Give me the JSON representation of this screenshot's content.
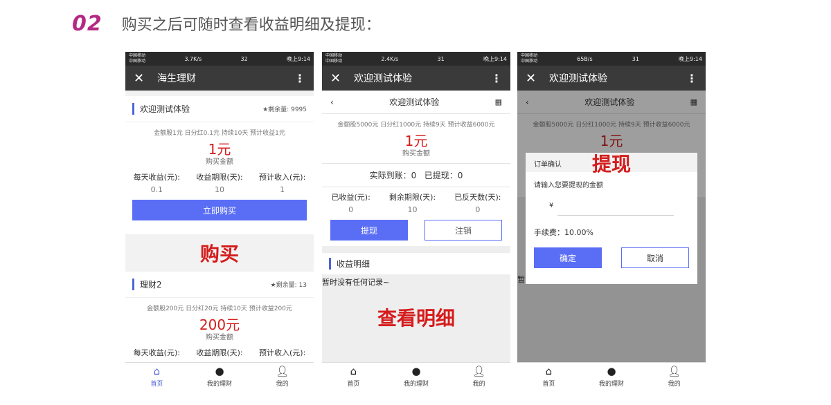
{
  "heading": {
    "number": "02",
    "text": "购买之后可随时查看收益明细及提现："
  },
  "phone1": {
    "status": {
      "carrier1": "中国移动",
      "carrier2": "中国移动",
      "speed": "3.7K/s",
      "battery": "32",
      "time": "晚上9:14"
    },
    "title": "海生理财",
    "products": [
      {
        "name": "欢迎测试体验",
        "stock_label": "剩余量:",
        "stock": "9995",
        "terms": "金额股1元 日分红0.1元 持续10天 预计收益1元",
        "price": "1元",
        "price_sub": "购买金额",
        "stats": [
          {
            "label": "每天收益(元):",
            "value": "0.1"
          },
          {
            "label": "收益期限(天):",
            "value": "10"
          },
          {
            "label": "预计收入(元):",
            "value": "1"
          }
        ],
        "button": "立即购买"
      },
      {
        "name": "理财2",
        "stock_label": "剩余量:",
        "stock": "13",
        "terms": "金额股200元 日分红20元 持续10天 预计收益200元",
        "price": "200元",
        "price_sub": "购买金额",
        "stats": [
          {
            "label": "每天收益(元):"
          },
          {
            "label": "收益期限(天):"
          },
          {
            "label": "预计收入(元):"
          }
        ]
      }
    ],
    "annotation": "购买"
  },
  "phone2": {
    "status": {
      "speed": "2.4K/s",
      "battery": "31",
      "time": "晚上9:14"
    },
    "title": "欢迎测试体验",
    "subtitle": "欢迎测试体验",
    "terms": "金额股5000元 日分红1000元 持续9天 预计收益6000元",
    "price": "1元",
    "price_sub": "购买金额",
    "balance": "实际到账：0   已提现：0",
    "stats": [
      {
        "label": "已收益(元):",
        "value": "0"
      },
      {
        "label": "剩余期限(天):",
        "value": "10"
      },
      {
        "label": "已反天数(天):",
        "value": "0"
      }
    ],
    "withdraw_button": "提现",
    "cancel_button": "注销",
    "details_title": "收益明细",
    "empty_text": "暂时没有任何记录~",
    "annotation": "查看明细"
  },
  "phone3": {
    "status": {
      "speed": "65B/s",
      "battery": "31",
      "time": "晚上9:14"
    },
    "title": "欢迎测试体验",
    "subtitle": "欢迎测试体验",
    "terms": "金额股5000元 日分红1000元 持续9天 预计收益6000元",
    "price": "1元",
    "dialog": {
      "title": "订单确认",
      "prompt": "请输入您要提现的金额",
      "currency": "¥",
      "fee": "手续费：10.00%",
      "confirm": "确定",
      "cancel": "取消"
    },
    "annotation": "提现",
    "partial_text": "暂"
  },
  "tabbar": [
    {
      "label": "首页"
    },
    {
      "label": "我的理财"
    },
    {
      "label": "我的"
    }
  ],
  "colors": {
    "accent": "#5a6ef5",
    "price_red": "#d51c1c",
    "step_magenta": "#b42a83",
    "appbar": "#3a3a3a"
  }
}
